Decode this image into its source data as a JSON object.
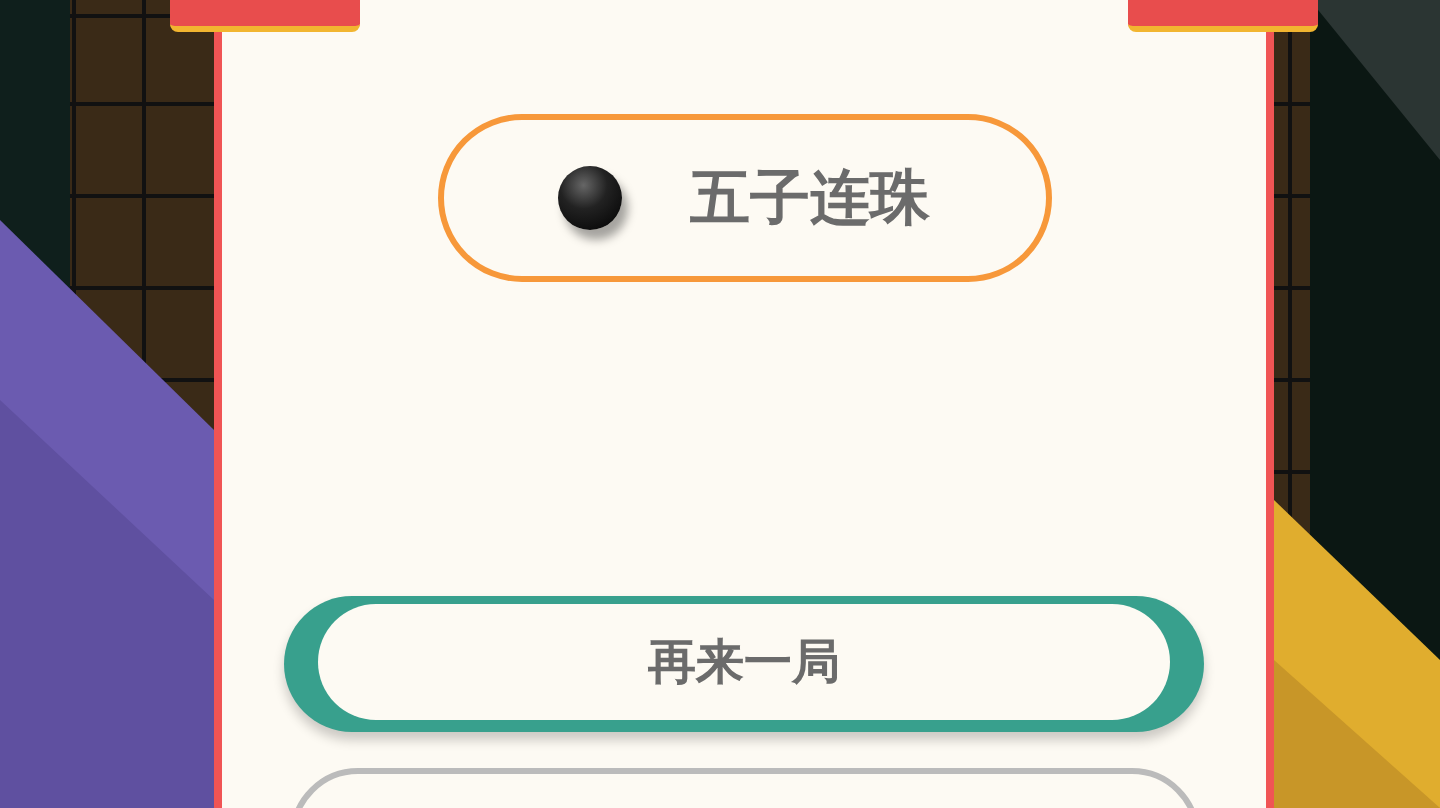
{
  "title_badge": {
    "label": "五子连珠"
  },
  "buttons": [
    {
      "label": "再来一局",
      "kind": "primary"
    },
    {
      "kind": "secondary"
    }
  ]
}
